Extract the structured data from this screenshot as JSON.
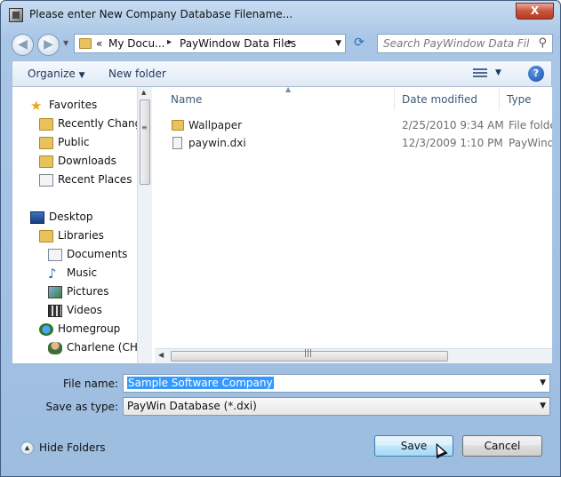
{
  "window": {
    "title": "Please enter New Company Database Filename...",
    "close_label": "X"
  },
  "nav": {
    "back_icon": "back-arrow-icon",
    "forward_icon": "forward-arrow-icon"
  },
  "address": {
    "prefix": "«",
    "segments": [
      "My Docu...",
      "PayWindow Data Files"
    ]
  },
  "search": {
    "placeholder": "Search PayWindow Data Files"
  },
  "toolbar": {
    "organize": "Organize",
    "new_folder": "New folder"
  },
  "sidebar": {
    "favorites": {
      "label": "Favorites",
      "items": [
        "Recently Changed",
        "Public",
        "Downloads",
        "Recent Places"
      ]
    },
    "desktop": "Desktop",
    "libraries": {
      "label": "Libraries",
      "items": [
        "Documents",
        "Music",
        "Pictures",
        "Videos"
      ]
    },
    "homegroup": {
      "label": "Homegroup",
      "items": [
        "Charlene (CHA"
      ]
    }
  },
  "columns": {
    "name": "Name",
    "date": "Date modified",
    "type": "Type"
  },
  "files": [
    {
      "name": "Wallpaper",
      "date": "2/25/2010 9:34 AM",
      "type": "File folder",
      "icon": "folder-icon"
    },
    {
      "name": "paywin.dxi",
      "date": "12/3/2009 1:10 PM",
      "type": "PayWindo",
      "icon": "document-icon"
    }
  ],
  "form": {
    "file_name_label": "File name:",
    "file_name_value": "Sample Software Company",
    "save_type_label": "Save as type:",
    "save_type_value": "PayWin Database (*.dxi)"
  },
  "footer": {
    "hide_folders": "Hide Folders",
    "save": "Save",
    "cancel": "Cancel"
  }
}
